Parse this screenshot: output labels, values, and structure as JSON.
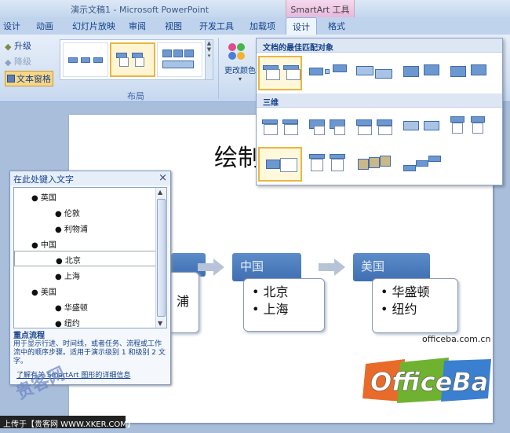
{
  "titlebar": {
    "title": "演示文稿1 - Microsoft PowerPoint",
    "context_tab_header": "SmartArt 工具"
  },
  "tabs": [
    "设计",
    "动画",
    "幻灯片放映",
    "审阅",
    "视图",
    "开发工具",
    "加载项",
    "设计",
    "格式"
  ],
  "ribbon": {
    "promote": "升级",
    "demote": "降级",
    "text_pane": "文本窗格",
    "group_layout": "布局",
    "change_colors": "更改颜色"
  },
  "dropdown": {
    "section_best": "文档的最佳匹配对象",
    "section_3d": "三维"
  },
  "slide": {
    "title": "绘制",
    "boxes": [
      {
        "head": "",
        "items": [
          "浦"
        ]
      },
      {
        "head": "中国",
        "items": [
          "北京",
          "上海"
        ]
      },
      {
        "head": "美国",
        "items": [
          "华盛顿",
          "纽约"
        ]
      }
    ]
  },
  "text_pane": {
    "title": "在此处键入文字",
    "close": "×",
    "items": [
      {
        "level": 1,
        "text": "英国"
      },
      {
        "level": 2,
        "text": "伦敦"
      },
      {
        "level": 2,
        "text": "利物浦"
      },
      {
        "level": 1,
        "text": "中国"
      },
      {
        "level": 2,
        "text": "北京"
      },
      {
        "level": 2,
        "text": "上海"
      },
      {
        "level": 1,
        "text": "美国"
      },
      {
        "level": 2,
        "text": "华盛顿"
      },
      {
        "level": 2,
        "text": "纽约"
      }
    ],
    "desc_title": "重点流程",
    "desc_text": "用于显示行进、时间线，或者任务、流程或工作流中的顺序步骤。适用于演示级别 1 和级别 2 文字。",
    "link": "了解有关 SmartArt 图形的详细信息"
  },
  "watermark": {
    "site": "officeba.com.cn",
    "logo": "OfficeBa",
    "footer": "上传于【贵客网 WWW.XKER.COM】",
    "stamp": "贵客网"
  }
}
